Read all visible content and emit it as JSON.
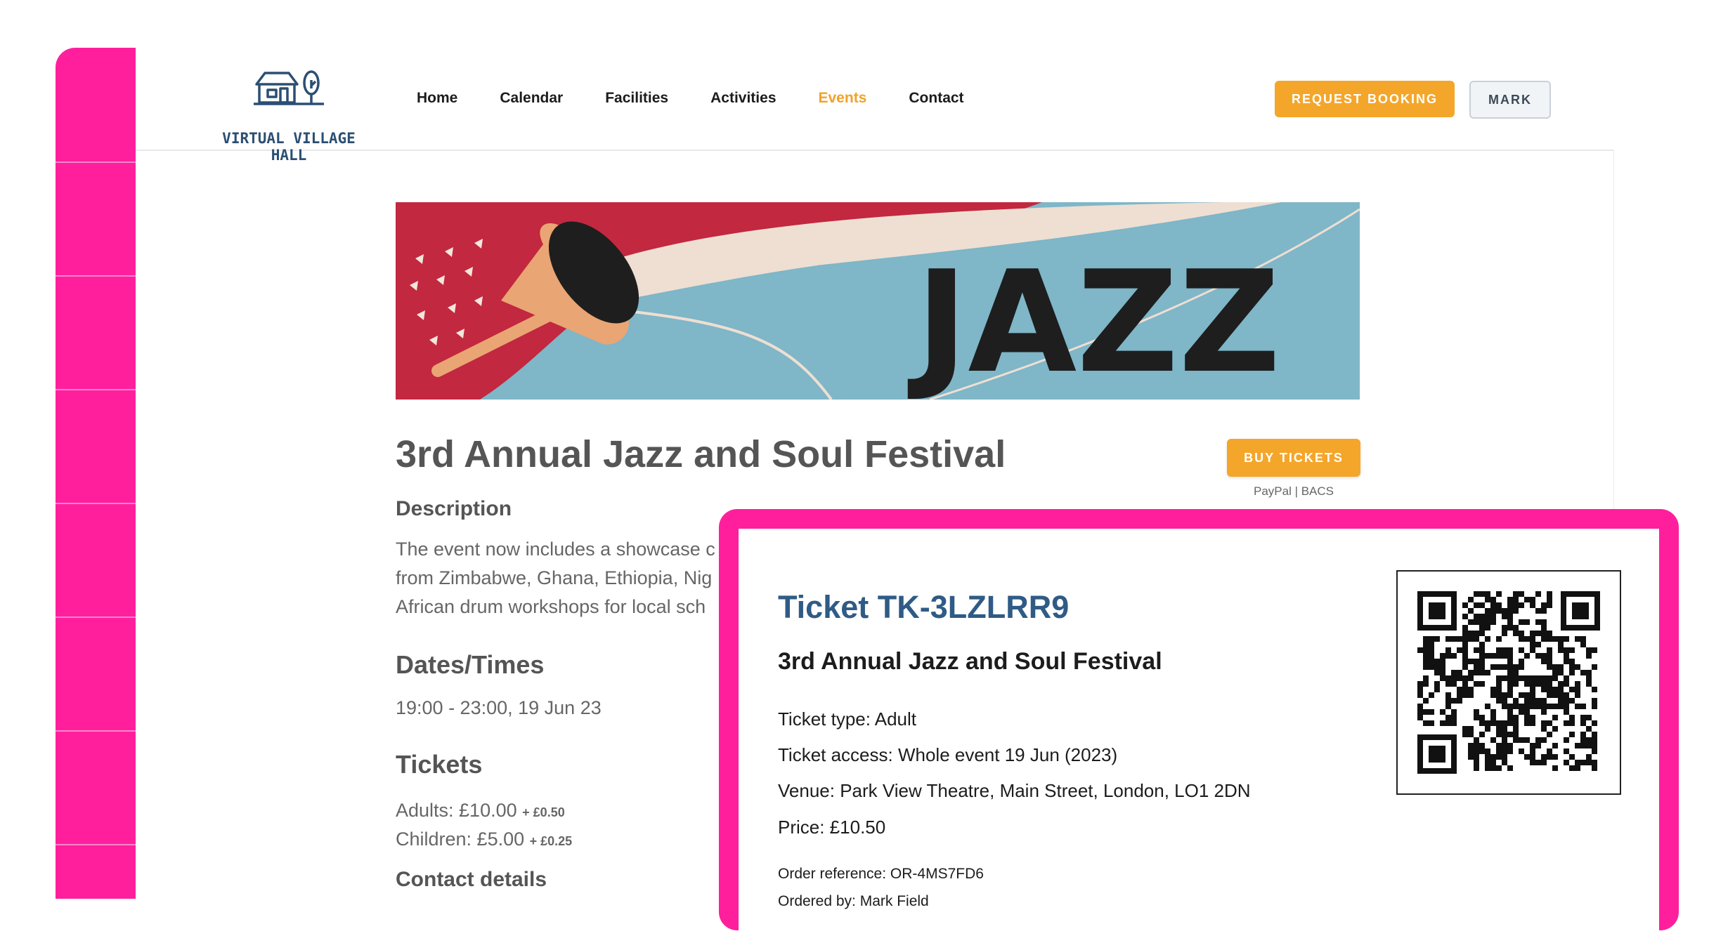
{
  "header": {
    "logo_text": "VIRTUAL VILLAGE HALL",
    "nav": [
      "Home",
      "Calendar",
      "Facilities",
      "Activities",
      "Events",
      "Contact"
    ],
    "active_nav": "Events",
    "request_booking_label": "REQUEST BOOKING",
    "user_label": "MARK"
  },
  "banner": {
    "text": "JAZZ"
  },
  "event": {
    "title": "3rd Annual Jazz and Soul Festival",
    "buy_label": "BUY TICKETS",
    "pay_methods": "PayPal | BACS",
    "description_heading": "Description",
    "description_lines": [
      "The event now includes a showcase c",
      "from Zimbabwe, Ghana, Ethiopia, Nig",
      "African drum workshops for local sch"
    ],
    "dates_heading": "Dates/Times",
    "dates_value": "19:00 - 23:00, 19 Jun 23",
    "tickets_heading": "Tickets",
    "adult_price": "Adults: £10.00",
    "adult_fee": "+ £0.50",
    "child_price": "Children: £5.00",
    "child_fee": "+ £0.25",
    "contact_heading": "Contact details"
  },
  "ticket": {
    "id": "Ticket TK-3LZLRR9",
    "event": "3rd Annual Jazz and Soul Festival",
    "type": "Ticket type: Adult",
    "access": "Ticket access: Whole event 19 Jun (2023)",
    "venue": "Venue: Park View Theatre, Main Street, London, LO1 2DN",
    "price": "Price: £10.50",
    "order_ref": "Order reference: OR-4MS7FD6",
    "ordered_by": "Ordered by: Mark Field"
  },
  "colors": {
    "accent": "#f4a62a",
    "highlight_pink": "#ff1f9d",
    "ticket_title": "#2f5b86",
    "logo": "#2b4f73"
  }
}
